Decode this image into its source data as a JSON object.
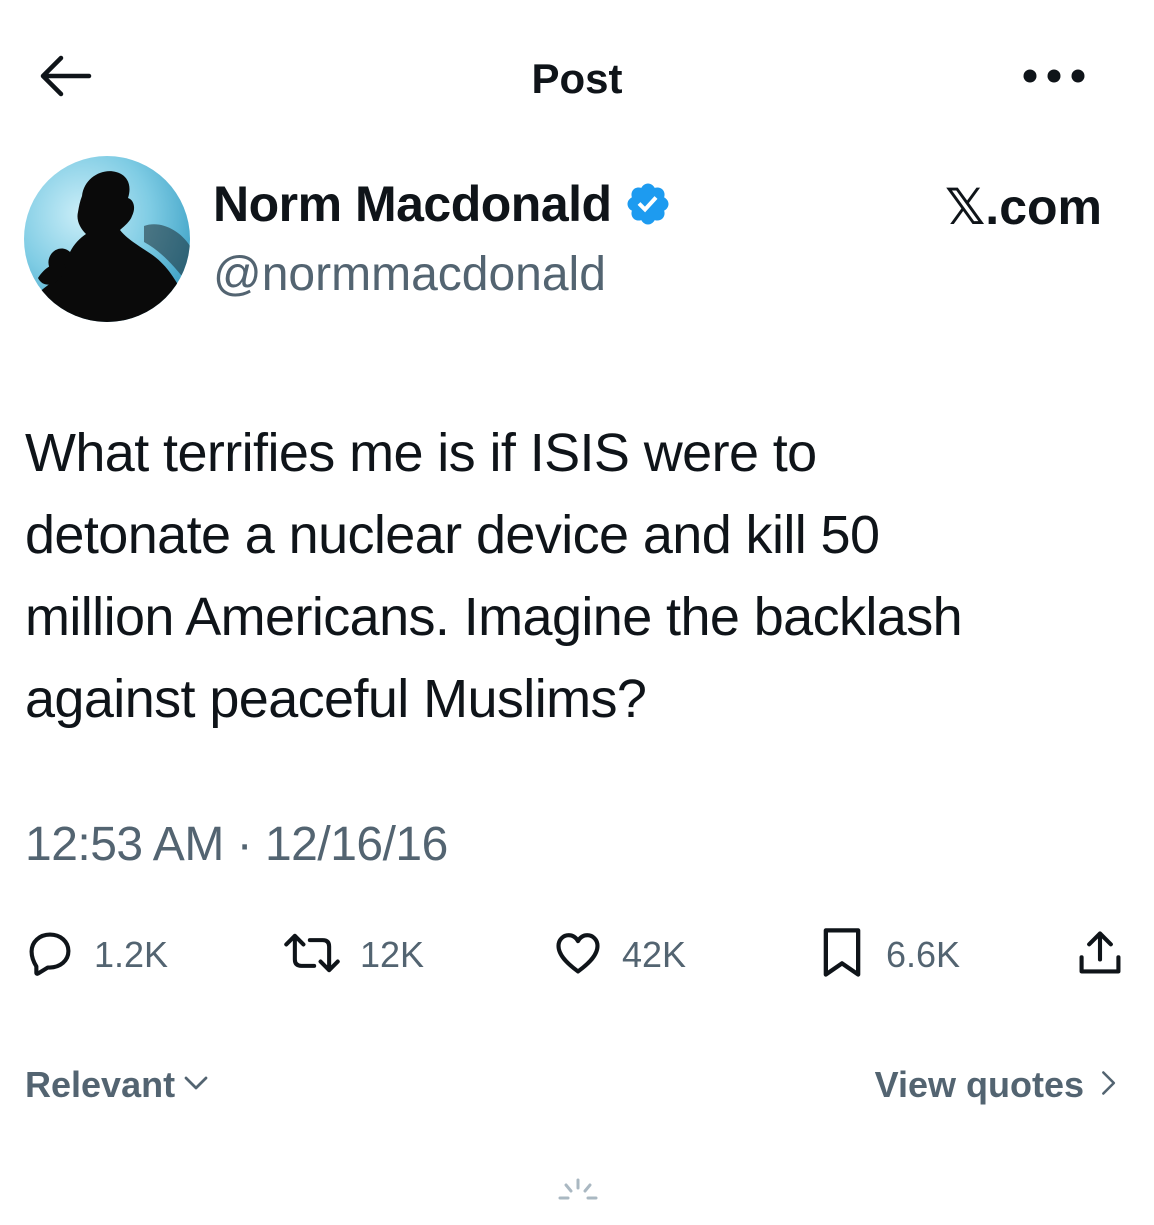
{
  "header": {
    "title": "Post",
    "back_icon": "arrow-left-icon",
    "more_icon": "more-horizontal-icon"
  },
  "author": {
    "display_name": "Norm Macdonald",
    "handle": "@normmacdonald",
    "verified": true,
    "verified_color": "#1d9bf0"
  },
  "brand": {
    "text": "𝕏.com"
  },
  "post": {
    "text": "What terrifies me is if ISIS were to\ndetonate a nuclear device and kill 50\nmillion Americans. Imagine the backlash\nagainst peaceful Muslims?",
    "timestamp": "12:53 AM · 12/16/16"
  },
  "actions": [
    {
      "icon": "reply-icon",
      "count": "1.2K"
    },
    {
      "icon": "repost-icon",
      "count": "12K"
    },
    {
      "icon": "like-icon",
      "count": "42K"
    },
    {
      "icon": "bookmark-icon",
      "count": "6.6K"
    },
    {
      "icon": "share-icon",
      "count": ""
    }
  ],
  "footer": {
    "sort_label": "Relevant",
    "view_quotes_label": "View quotes"
  },
  "colors": {
    "text_primary": "#0f1419",
    "text_secondary": "#536471",
    "accent": "#1d9bf0"
  }
}
